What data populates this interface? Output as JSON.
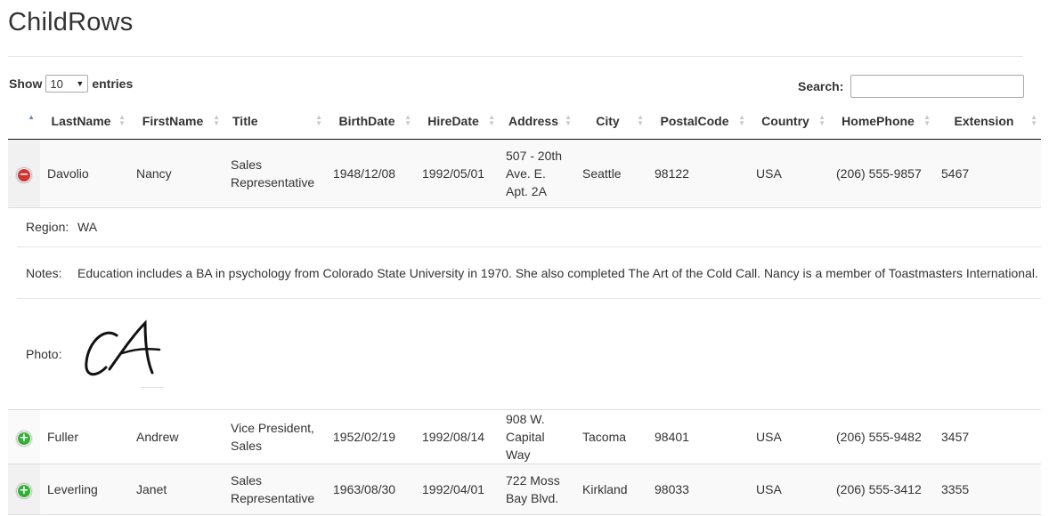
{
  "page": {
    "title": "ChildRows"
  },
  "length_control": {
    "show_label": "Show",
    "selected": "10",
    "entries_label": "entries"
  },
  "search": {
    "label": "Search:",
    "value": ""
  },
  "table": {
    "columns": [
      "LastName",
      "FirstName",
      "Title",
      "BirthDate",
      "HireDate",
      "Address",
      "City",
      "PostalCode",
      "Country",
      "HomePhone",
      "Extension"
    ],
    "rows": [
      {
        "last": "Davolio",
        "first": "Nancy",
        "title": "Sales Representative",
        "birth": "1948/12/08",
        "hire": "1992/05/01",
        "address": "507 - 20th Ave. E. Apt. 2A",
        "city": "Seattle",
        "postal": "98122",
        "country": "USA",
        "phone": "(206) 555-9857",
        "ext": "5467",
        "expanded": true
      },
      {
        "last": "Fuller",
        "first": "Andrew",
        "title": "Vice President, Sales",
        "birth": "1952/02/19",
        "hire": "1992/08/14",
        "address": "908 W. Capital Way",
        "city": "Tacoma",
        "postal": "98401",
        "country": "USA",
        "phone": "(206) 555-9482",
        "ext": "3457",
        "expanded": false
      },
      {
        "last": "Leverling",
        "first": "Janet",
        "title": "Sales Representative",
        "birth": "1963/08/30",
        "hire": "1992/04/01",
        "address": "722 Moss Bay Blvd.",
        "city": "Kirkland",
        "postal": "98033",
        "country": "USA",
        "phone": "(206) 555-3412",
        "ext": "3355",
        "expanded": false
      }
    ]
  },
  "child_detail": {
    "region_label": "Region:",
    "region_value": "WA",
    "notes_label": "Notes:",
    "notes_value": "Education includes a BA in psychology from Colorado State University in 1970. She also completed The Art of the Cold Call. Nancy is a member of Toastmasters International.",
    "photo_label": "Photo:"
  },
  "icons": {
    "expand": "plus-circle-icon",
    "collapse": "minus-circle-icon",
    "sort_asc": "sort-asc-icon",
    "sort_both": "sort-both-icon"
  },
  "colors": {
    "collapse_button": "#d33333",
    "expand_button": "#31b131",
    "sort_active": "#6e86c9"
  }
}
